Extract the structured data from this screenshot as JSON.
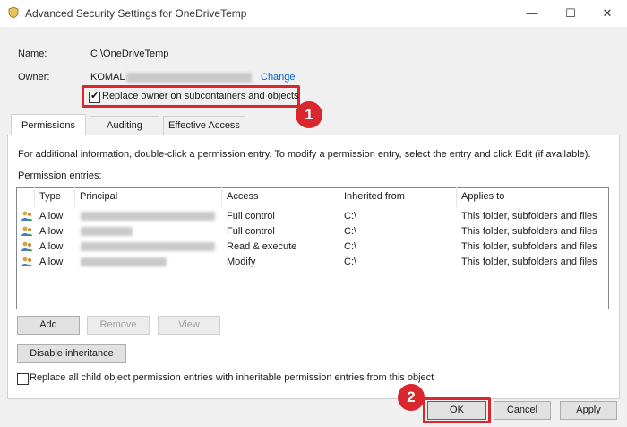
{
  "window": {
    "title": "Advanced Security Settings for OneDriveTemp",
    "minimize_glyph": "—",
    "maximize_glyph": "☐",
    "close_glyph": "✕"
  },
  "info": {
    "name_label": "Name:",
    "name_value": "C:\\OneDriveTemp",
    "owner_label": "Owner:",
    "owner_value": "KOMAL",
    "change_link": "Change",
    "replace_owner_label": "Replace owner on subcontainers and objects",
    "replace_owner_checked": true,
    "check_glyph": "✔"
  },
  "tabs": [
    {
      "label": "Permissions",
      "active": true
    },
    {
      "label": "Auditing",
      "active": false
    },
    {
      "label": "Effective Access",
      "active": false
    }
  ],
  "help_text": "For additional information, double-click a permission entry. To modify a permission entry, select the entry and click Edit (if available).",
  "entries_label": "Permission entries:",
  "table": {
    "columns": [
      "Type",
      "Principal",
      "Access",
      "Inherited from",
      "Applies to"
    ],
    "rows": [
      {
        "type": "Allow",
        "access": "Full control",
        "inherited_from": "C:\\",
        "applies_to": "This folder, subfolders and files"
      },
      {
        "type": "Allow",
        "access": "Full control",
        "inherited_from": "C:\\",
        "applies_to": "This folder, subfolders and files"
      },
      {
        "type": "Allow",
        "access": "Read & execute",
        "inherited_from": "C:\\",
        "applies_to": "This folder, subfolders and files"
      },
      {
        "type": "Allow",
        "access": "Modify",
        "inherited_from": "C:\\",
        "applies_to": "This folder, subfolders and files"
      }
    ]
  },
  "buttons": {
    "add": "Add",
    "remove": "Remove",
    "view": "View",
    "disable_inheritance": "Disable inheritance",
    "ok": "OK",
    "cancel": "Cancel",
    "apply": "Apply"
  },
  "replace_child_label": "Replace all child object permission entries with inheritable permission entries from this object",
  "replace_child_checked": false,
  "callouts": {
    "first": "1",
    "second": "2"
  },
  "colors": {
    "highlight": "#d9272e",
    "link": "#0066cc"
  }
}
